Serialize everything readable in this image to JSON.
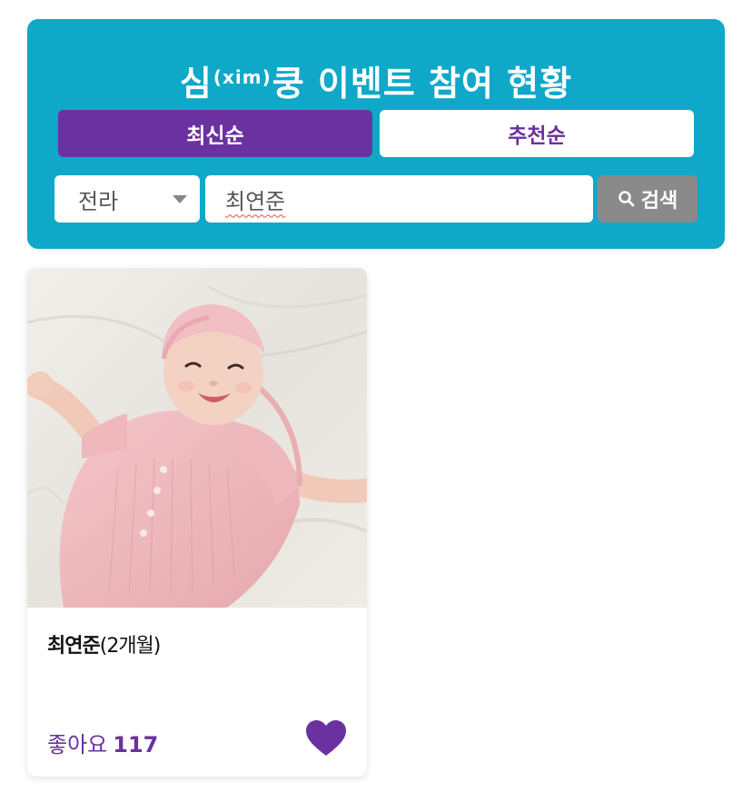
{
  "header": {
    "title_prefix": "심",
    "title_sup": "(xim)",
    "title_suffix": "쿵 이벤트 참여 현황"
  },
  "tabs": [
    {
      "label": "최신순",
      "active": true
    },
    {
      "label": "추천순",
      "active": false
    }
  ],
  "search": {
    "region_selected": "전라",
    "query_value": "최연준",
    "button_label": "검색"
  },
  "cards": [
    {
      "name": "최연준",
      "age": "(2개월)",
      "likes_label": "좋아요",
      "likes_count": "117"
    }
  ],
  "colors": {
    "header_bg": "#0fa8c8",
    "accent_purple": "#6b31a1",
    "search_button_bg": "#8a8a8a"
  },
  "icons": {
    "search": "magnifier-icon",
    "dropdown": "caret-down-icon",
    "like": "heart-icon"
  }
}
